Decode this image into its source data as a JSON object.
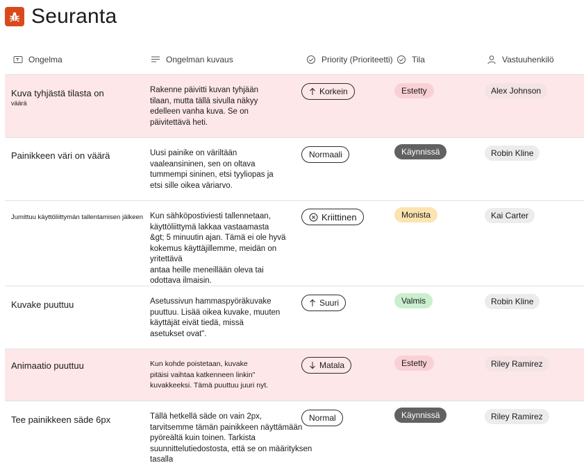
{
  "app": {
    "title": "Seuranta",
    "icon": "bug-icon"
  },
  "colors": {
    "logo": "#d84a1b",
    "blocked_row": "#fde7e9",
    "blocked_badge": "#f9d1d5",
    "in_progress_badge": "#616161",
    "many_badge": "#fbe4b0",
    "done_badge": "#c9efcf"
  },
  "columns": [
    {
      "label": "Ongelma",
      "icon": "title-field-icon"
    },
    {
      "label": "Ongelman kuvaus",
      "icon": "text-lines-icon"
    },
    {
      "label": "Priority (Prioriteetti)",
      "icon": "choice-check-icon"
    },
    {
      "label": "Tila",
      "icon": "choice-check-icon"
    },
    {
      "label": "Vastuuhenkilö",
      "icon": "person-icon"
    }
  ],
  "rows": [
    {
      "title_line1": "Kuva tyhjästä tilasta on",
      "title_line2": "väärä",
      "description": [
        "Rakenne päivitti kuvan tyhjään",
        "tilaan, mutta tällä sivulla näkyy",
        "edelleen vanha kuva. Se on",
        "päivitettävä heti."
      ],
      "priority": "Korkein",
      "priority_icon": "arrow-up-icon",
      "status": "Estetty",
      "assignee": "Alex Johnson"
    },
    {
      "title_line1": "Painikkeen väri on väärä",
      "description": [
        "Uusi painike on väriltään",
        "vaaleansininen, sen on oltava",
        "tummempi sininen, etsi tyyliopas ja",
        "etsi sille oikea väriarvo."
      ],
      "priority": "Normaali",
      "priority_icon": "",
      "status": "Käynnissä",
      "assignee": "Robin Kline"
    },
    {
      "title_line1": "Jumittuu käyttöliittymän tallentamisen jälkeen",
      "description": [
        "Kun sähköpostiviesti tallennetaan,",
        "käyttöliittymä lakkaa vastaamasta",
        "&gt; 5 minuutin ajan. Tämä ei ole hyvä",
        "kokemus käyttäjillemme, meidän on yritettävä",
        "antaa heille meneillään oleva tai",
        "odottava ilmaisin."
      ],
      "priority": "Kriittinen",
      "priority_icon": "circle-x-icon",
      "status": "Monista",
      "assignee": "Kai Carter"
    },
    {
      "title_line1": "Kuvake puuttuu",
      "description": [
        "Asetussivun hammaspyöräkuvake",
        "puuttuu. Lisää oikea kuvake, muuten",
        "käyttäjät eivät tiedä, missä",
        "asetukset ovat\"."
      ],
      "priority": "Suuri",
      "priority_icon": "arrow-up-icon",
      "status": "Valmis",
      "assignee": "Robin Kline"
    },
    {
      "title_line1": "Animaatio puuttuu",
      "description": [
        "Kun kohde poistetaan, kuvake",
        "pitäisi vaihtaa katkenneen linkin\"",
        "kuvakkeeksi. Tämä puuttuu juuri nyt."
      ],
      "priority": "Matala",
      "priority_icon": "arrow-down-icon",
      "status": "Estetty",
      "assignee": "Riley Ramirez"
    },
    {
      "title_line1": "Tee painikkeen säde 6px",
      "description": [
        "Tällä hetkellä säde on vain 2px,",
        "tarvitsemme tämän painikkeen näyttämään",
        "pyöreältä kuin toinen. Tarkista",
        "suunnittelutiedostosta, että se on määrityksen tasalla"
      ],
      "priority": "Normal",
      "priority_icon": "",
      "status": "Käynnissä",
      "assignee": "Riley Ramirez"
    }
  ]
}
